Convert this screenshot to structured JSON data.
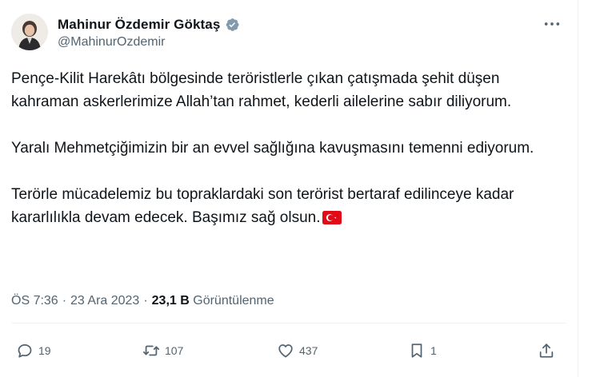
{
  "author": {
    "display_name": "Mahinur Özdemir Göktaş",
    "handle": "@MahinurOzdemir",
    "verified_icon": "verified-badge-icon"
  },
  "tweet": {
    "paragraphs": [
      "Pençe-Kilit Harekâtı bölgesinde teröristlerle çıkan çatışmada şehit düşen kahraman askerlerimize Allah’tan rahmet, kederli ailelerine sabır diliyorum.",
      "Yaralı Mehmetçiğimizin bir an evvel sağlığına kavuşmasını temenni ediyorum.",
      "Terörle mücadelemiz bu topraklardaki son terörist bertaraf edilinceye kadar kararlılıkla devam edecek. Başımız sağ olsun."
    ],
    "flag_icon": "turkey-flag-emoji"
  },
  "meta": {
    "time": "ÖS 7:36",
    "separator": "·",
    "date": "23 Ara 2023",
    "views_count": "23,1 B",
    "views_label": "Görüntülenme"
  },
  "actions": {
    "replies": "19",
    "reposts": "107",
    "likes": "437",
    "bookmarks": "1"
  },
  "colors": {
    "text_primary": "#0f1419",
    "text_secondary": "#536471",
    "verified": "#829aab",
    "divider": "#eff3f4",
    "flag_red": "#e30a17"
  }
}
